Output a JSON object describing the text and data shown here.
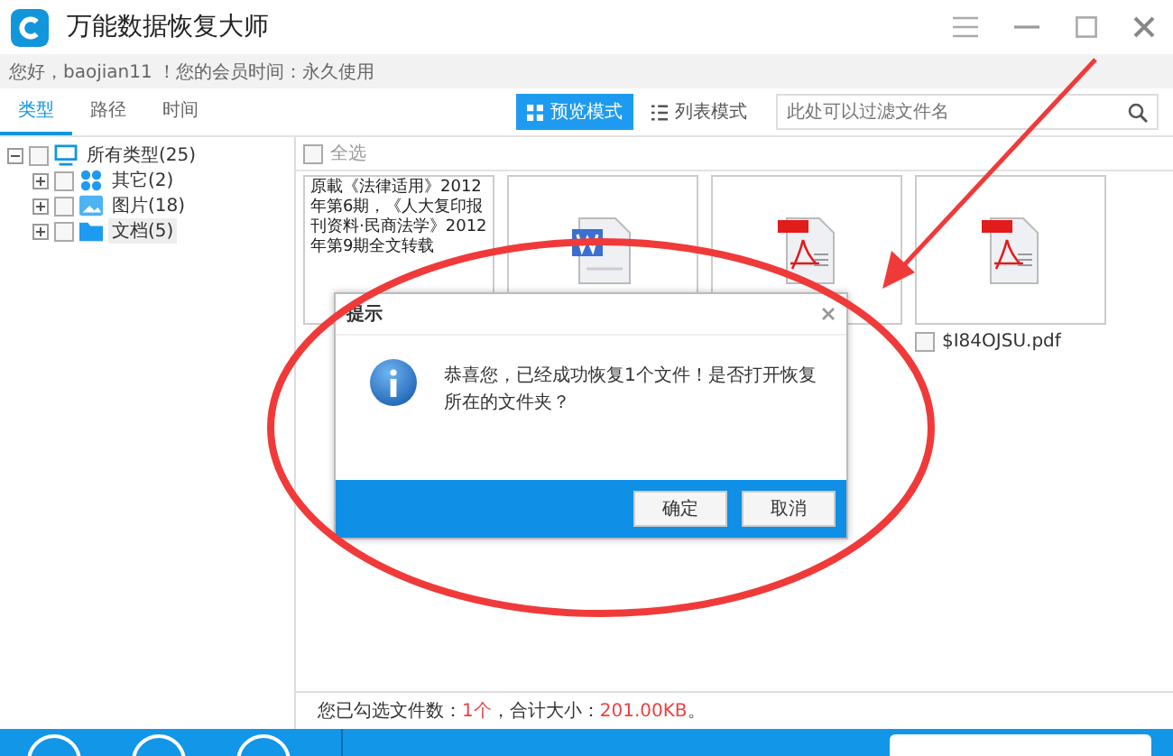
{
  "window": {
    "title": "万能数据恢复大师"
  },
  "greeting": "您好，baojian11 ！您的会员时间：永久使用",
  "tabs": [
    {
      "label": "类型",
      "selected": true
    },
    {
      "label": "路径",
      "selected": false
    },
    {
      "label": "时间",
      "selected": false
    }
  ],
  "view_modes": [
    {
      "label": "预览模式",
      "selected": true,
      "kind": "grid"
    },
    {
      "label": "列表模式",
      "selected": false,
      "kind": "list"
    }
  ],
  "search": {
    "placeholder": "此处可以过滤文件名"
  },
  "tree": [
    {
      "label": "所有类型(25)",
      "kind": "computer",
      "checked": false,
      "expanded": true,
      "selected": false,
      "children": [
        {
          "label": "其它(2)",
          "kind": "other",
          "checked": false,
          "expanded": false,
          "selected": false
        },
        {
          "label": "图片(18)",
          "kind": "image",
          "checked": false,
          "expanded": false,
          "selected": false
        },
        {
          "label": "文档(5)",
          "kind": "folder",
          "checked": false,
          "expanded": false,
          "selected": true
        }
      ]
    }
  ],
  "select_all": {
    "label": "全选",
    "checked": false
  },
  "files": [
    {
      "kind": "text",
      "lines": [
        "原載《法律适用》2012",
        "年第6期，《人大复印报",
        "刊资料·民商法学》2012",
        "年第9期全文转载"
      ]
    },
    {
      "kind": "word"
    },
    {
      "kind": "pdf"
    },
    {
      "kind": "pdf",
      "name": "$I84OJSU.pdf",
      "checked": false
    }
  ],
  "status": {
    "label": "您已勾选文件数：",
    "count": "1个",
    "sep": "，合计大小：",
    "size": "201.00KB",
    "end": "。"
  },
  "dialog": {
    "title": "提示",
    "message": "恭喜您，已经成功恢复1个文件！是否打开恢复所在的文件夹？",
    "buttons": [
      "确定",
      "取消"
    ]
  }
}
